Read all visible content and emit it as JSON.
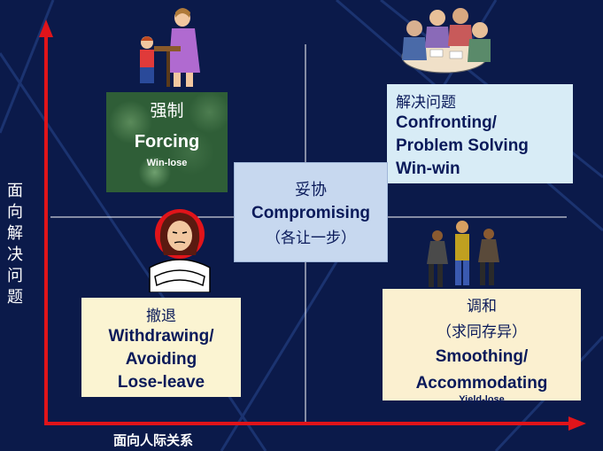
{
  "axes": {
    "y_label_chars": [
      "面",
      "向",
      "解",
      "决",
      "问",
      "题"
    ],
    "x_label": "面向人际关系"
  },
  "forcing": {
    "zh": "强制",
    "en": "Forcing",
    "outcome": "Win-lose"
  },
  "compromise": {
    "zh": "妥协",
    "en": "Compromising",
    "zh_note": "（各让一步）"
  },
  "confronting": {
    "zh": "解决问题",
    "en_lines": [
      "Confronting/",
      "Problem Solving",
      "Win-win"
    ]
  },
  "withdrawing": {
    "zh": "撤退",
    "en_lines": [
      "Withdrawing/",
      "Avoiding",
      "Lose-leave"
    ]
  },
  "smoothing": {
    "zh": "调和",
    "zh_note": "（求同存异）",
    "en_lines": [
      "Smoothing/",
      "Accommodating"
    ],
    "outcome": "Yield-lose"
  },
  "colors": {
    "background": "#0b1a4a",
    "axis": "#e0141a",
    "text_dark": "#0a1a5a"
  }
}
